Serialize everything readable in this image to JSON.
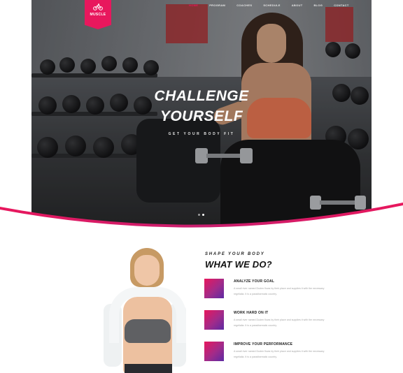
{
  "logo": {
    "text": "MUSCLE",
    "icon": "cyclist-icon"
  },
  "nav": {
    "items": [
      {
        "label": "HOME",
        "active": true
      },
      {
        "label": "PROGRAM",
        "active": false
      },
      {
        "label": "COACHES",
        "active": false
      },
      {
        "label": "SCHEDULE",
        "active": false
      },
      {
        "label": "ABOUT",
        "active": false
      },
      {
        "label": "BLOG",
        "active": false
      },
      {
        "label": "CONTACT",
        "active": false
      }
    ]
  },
  "hero": {
    "title_line1": "CHALLENGE",
    "title_line2": "YOURSELF",
    "subtitle": "GET YOUR BODY FIT",
    "slides": 2,
    "active_slide": 2
  },
  "section": {
    "eyebrow": "SHAPE YOUR BODY",
    "title": "WHAT WE DO?",
    "features": [
      {
        "title": "ANALYZE YOUR GOAL",
        "desc": "A small river named Duden flows by their place and supplies it with the necessary regelialia. It is a paradisematic country."
      },
      {
        "title": "WORK HARD ON IT",
        "desc": "A small river named Duden flows by their place and supplies it with the necessary regelialia. It is a paradisematic country."
      },
      {
        "title": "IMPROVE YOUR PERFORMANCE",
        "desc": "A small river named Duden flows by their place and supplies it with the necessary regelialia. It is a paradisematic country."
      }
    ]
  },
  "colors": {
    "accent": "#e8175d",
    "gradient_end": "#5d2aa3"
  }
}
